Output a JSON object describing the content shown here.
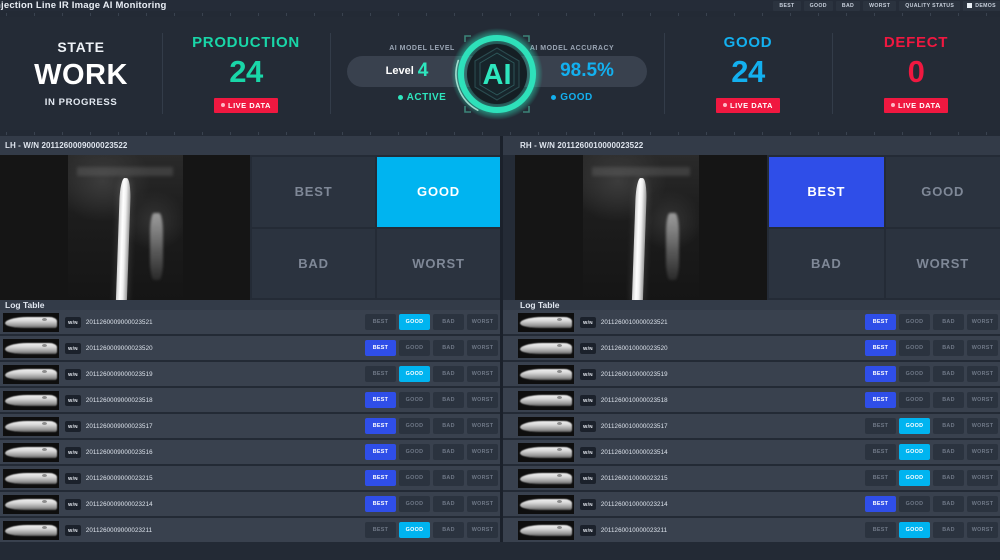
{
  "topbar": {
    "title": "njection Line IR Image AI Monitoring",
    "buttons": [
      "BEST",
      "GOOD",
      "BAD",
      "WORST",
      "QUALITY STATUS"
    ],
    "demos_label": "DEMOS",
    "demos_checked": true
  },
  "kpis": {
    "state": {
      "label": "STATE",
      "value": "WORK",
      "sub": "IN PROGRESS"
    },
    "production": {
      "label": "PRODUCTION",
      "value": "24",
      "badge": "LIVE DATA"
    },
    "good": {
      "label": "GOOD",
      "value": "24",
      "badge": "LIVE DATA"
    },
    "defect": {
      "label": "DEFECT",
      "value": "0",
      "badge": "LIVE DATA"
    }
  },
  "ai": {
    "level_label": "AI MODEL LEVEL",
    "level_prefix": "Level",
    "level_value": "4",
    "level_status": "ACTIVE",
    "badge_text": "AI",
    "accuracy_label": "AI MODEL ACCURACY",
    "accuracy_value": "98.5%",
    "accuracy_status": "GOOD"
  },
  "panels": [
    {
      "header": "LH - W/N 2011260009000023522",
      "grades": [
        "BEST",
        "GOOD",
        "BAD",
        "WORST"
      ],
      "active": "GOOD",
      "active_style": "on-good"
    },
    {
      "header": "RH - W/N 2011260010000023522",
      "grades": [
        "BEST",
        "GOOD",
        "BAD",
        "WORST"
      ],
      "active": "BEST",
      "active_style": "on-best"
    }
  ],
  "logs": [
    {
      "title": "Log Table",
      "wn_label": "W/N",
      "grades": [
        "BEST",
        "GOOD",
        "BAD",
        "WORST"
      ],
      "rows": [
        {
          "serial": "2011260009000023521",
          "active": "GOOD",
          "style": "on-good"
        },
        {
          "serial": "2011260009000023520",
          "active": "BEST",
          "style": "on-best"
        },
        {
          "serial": "2011260009000023519",
          "active": "GOOD",
          "style": "on-good"
        },
        {
          "serial": "2011260009000023518",
          "active": "BEST",
          "style": "on-best"
        },
        {
          "serial": "2011260009000023517",
          "active": "BEST",
          "style": "on-best"
        },
        {
          "serial": "2011260009000023516",
          "active": "BEST",
          "style": "on-best"
        },
        {
          "serial": "2011260009000023215",
          "active": "BEST",
          "style": "on-best"
        },
        {
          "serial": "2011260009000023214",
          "active": "BEST",
          "style": "on-best"
        },
        {
          "serial": "2011260009000023211",
          "active": "GOOD",
          "style": "on-good"
        }
      ]
    },
    {
      "title": "Log Table",
      "wn_label": "W/N",
      "grades": [
        "BEST",
        "GOOD",
        "BAD",
        "WORST"
      ],
      "rows": [
        {
          "serial": "2011260010000023521",
          "active": "BEST",
          "style": "on-best"
        },
        {
          "serial": "2011260010000023520",
          "active": "BEST",
          "style": "on-best"
        },
        {
          "serial": "2011260010000023519",
          "active": "BEST",
          "style": "on-best"
        },
        {
          "serial": "2011260010000023518",
          "active": "BEST",
          "style": "on-best"
        },
        {
          "serial": "2011260010000023517",
          "active": "GOOD",
          "style": "on-good"
        },
        {
          "serial": "2011260010000023514",
          "active": "GOOD",
          "style": "on-good"
        },
        {
          "serial": "2011260010000023215",
          "active": "GOOD",
          "style": "on-good"
        },
        {
          "serial": "2011260010000023214",
          "active": "BEST",
          "style": "on-best"
        },
        {
          "serial": "2011260010000023211",
          "active": "GOOD",
          "style": "on-good"
        }
      ]
    }
  ],
  "colors": {
    "accent_teal": "#19d6a8",
    "accent_cyan": "#13b0ef",
    "accent_red": "#f01840",
    "chip_good": "#00b4f0",
    "chip_best": "#2f4ee8",
    "ai_glow": "#2ee6be",
    "bg": "#232a35",
    "panel": "#2b333f",
    "row": "#39414e"
  }
}
